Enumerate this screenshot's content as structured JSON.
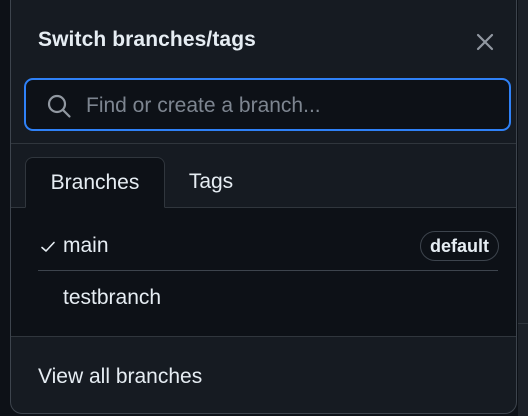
{
  "dialog": {
    "title": "Switch branches/tags",
    "close_icon": "close-icon"
  },
  "search": {
    "value": "",
    "placeholder": "Find or create a branch...",
    "icon": "search-icon"
  },
  "tabs": [
    {
      "label": "Branches",
      "active": true
    },
    {
      "label": "Tags",
      "active": false
    }
  ],
  "branches": [
    {
      "name": "main",
      "selected": true,
      "badge": "default"
    },
    {
      "name": "testbranch",
      "selected": false,
      "badge": ""
    }
  ],
  "footer": {
    "link_label": "View all branches"
  },
  "colors": {
    "background": "#161b22",
    "list_background": "#0d1117",
    "accent": "#2f81f7",
    "text": "#e6edf3",
    "muted": "#7d8590",
    "border": "#30363d"
  }
}
